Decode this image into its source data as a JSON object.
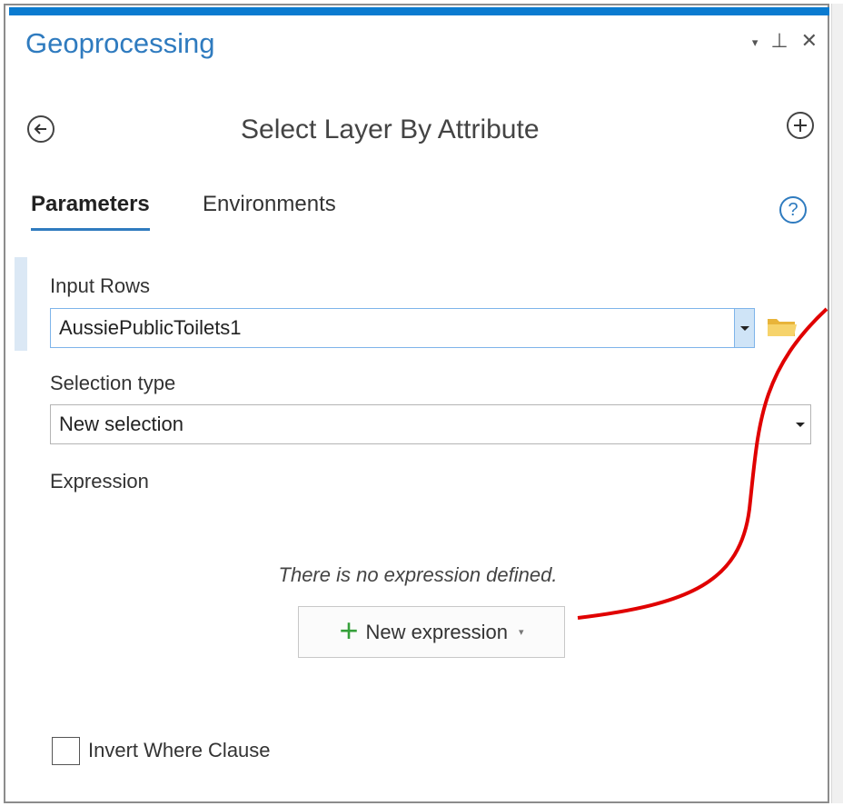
{
  "pane": {
    "title": "Geoprocessing",
    "controls": {
      "dropdown": "▾",
      "pin": "⊥",
      "close": "✕"
    }
  },
  "tool": {
    "title": "Select Layer By Attribute"
  },
  "tabs": {
    "parameters": "Parameters",
    "environments": "Environments"
  },
  "help_label": "?",
  "params": {
    "input_rows": {
      "label": "Input Rows",
      "value": "AussiePublicToilets1"
    },
    "selection_type": {
      "label": "Selection type",
      "value": "New selection"
    },
    "expression": {
      "label": "Expression",
      "empty_message": "There is no expression defined.",
      "new_button_label": "New expression",
      "new_button_plus": "+",
      "new_button_caret": "▾"
    },
    "invert": {
      "label": "Invert Where Clause",
      "checked": false
    }
  },
  "colors": {
    "accent": "#0a7bd0",
    "title": "#2f7bbf",
    "plus_green": "#35a03a",
    "annotation_red": "#e00000"
  }
}
